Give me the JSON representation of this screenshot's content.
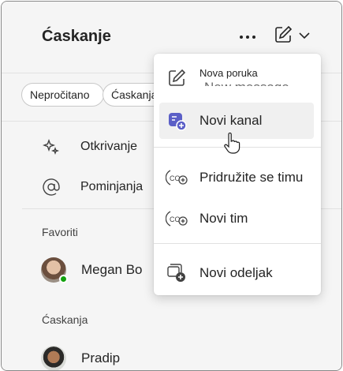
{
  "header": {
    "title": "Ćaskanje",
    "more_icon": "more-horizontal-icon",
    "compose_icon": "compose-icon",
    "chevron_icon": "chevron-down-icon"
  },
  "filters": {
    "chips": [
      "Nepročitano",
      "Ćaskanja"
    ]
  },
  "nav": {
    "discover": "Otkrivanje",
    "mentions": "Pominjanja"
  },
  "sections": {
    "favorites_label": "Favoriti",
    "chats_label": "Ćaskanja"
  },
  "contacts": {
    "favorite": "Megan Bo",
    "chat": "Pradip"
  },
  "menu": {
    "items": [
      {
        "label": "Nova poruka",
        "ghost": "New message",
        "icon": "compose-icon"
      },
      {
        "label": "Novi kanal",
        "icon": "new-channel-icon"
      },
      {
        "label": "Pridružite se timu",
        "icon": "join-team-icon"
      },
      {
        "label": "Novi tim",
        "icon": "new-team-icon"
      },
      {
        "label": "Novi odeljak",
        "icon": "new-section-icon"
      }
    ]
  },
  "colors": {
    "accent": "#5b5fc7",
    "presence_available": "#13a10e",
    "background": "#f5f5f5"
  }
}
